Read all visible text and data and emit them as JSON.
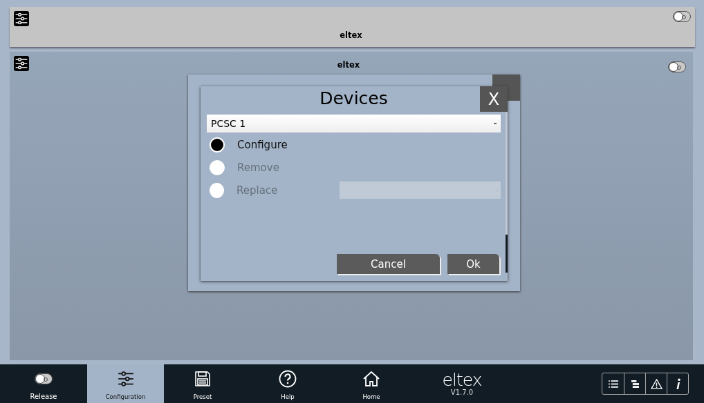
{
  "top_bar": {
    "title": "eltex",
    "toggle_on": false
  },
  "panel": {
    "title": "eltex",
    "toggle_on": false
  },
  "config_dialog": {
    "has_close": true
  },
  "devices_dialog": {
    "title": "Devices",
    "close": "X",
    "device": "PCSC 1",
    "options": [
      {
        "label": "Configure",
        "kind": "radio",
        "selected": true,
        "disabled": false
      },
      {
        "label": "Remove",
        "kind": "radio",
        "selected": false,
        "disabled": true
      },
      {
        "label": "Replace",
        "kind": "radio-select",
        "selected": false,
        "disabled": true
      }
    ],
    "buttons": [
      "Cancel",
      "Ok"
    ]
  },
  "nav": {
    "items": [
      {
        "label": "Release",
        "kind": "toggle",
        "selected": false
      },
      {
        "label": "Configuration",
        "kind": "sliders",
        "selected": true
      },
      {
        "label": "Preset",
        "kind": "disk",
        "selected": false
      },
      {
        "label": "Help",
        "kind": "help",
        "selected": false
      },
      {
        "label": "Home",
        "kind": "home",
        "selected": false
      }
    ],
    "logo": "eltex",
    "version": "V1.7.0",
    "tools": [
      {
        "kind": "list"
      },
      {
        "kind": "tree"
      },
      {
        "kind": "warning"
      },
      {
        "kind": "info"
      }
    ]
  }
}
